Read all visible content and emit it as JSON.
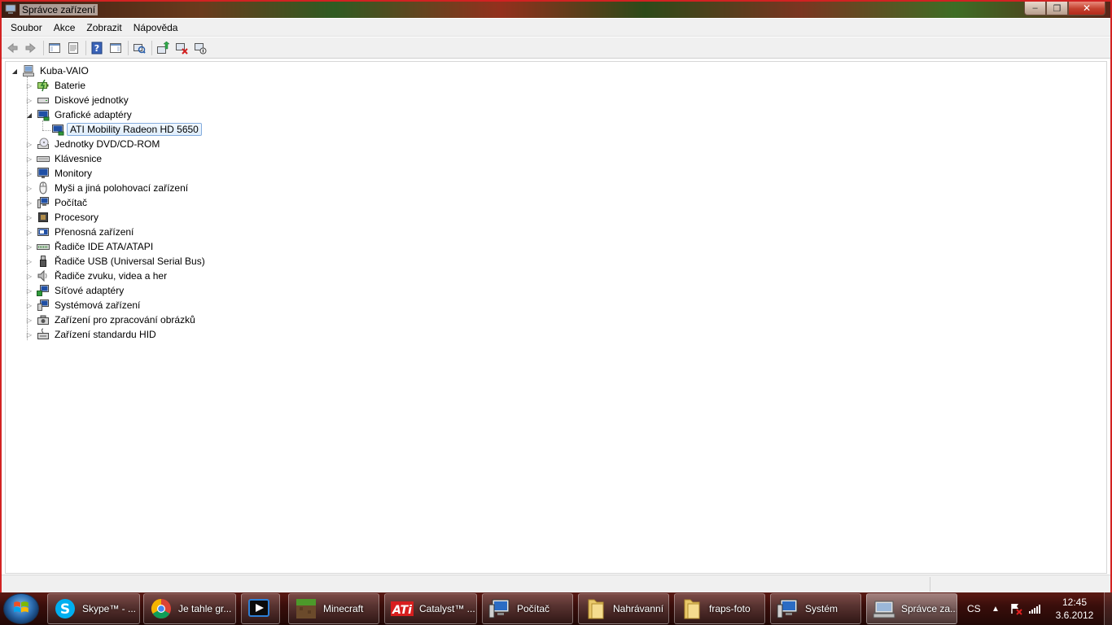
{
  "window": {
    "title": "Správce zařízení",
    "controls": {
      "minimize": "‒",
      "maximize": "❐",
      "close": "✕"
    }
  },
  "menu": [
    "Soubor",
    "Akce",
    "Zobrazit",
    "Nápověda"
  ],
  "toolbar": [
    "back-icon",
    "forward-icon",
    "console-tree-icon",
    "properties-icon",
    "help-icon",
    "action-pane-icon",
    "scan-hardware-icon",
    "update-driver-icon",
    "uninstall-icon",
    "disable-device-icon"
  ],
  "tree": {
    "root": "Kuba-VAIO",
    "items": [
      {
        "label": "Baterie",
        "icon": "battery-icon",
        "expanded": false
      },
      {
        "label": "Diskové jednotky",
        "icon": "disk-drive-icon",
        "expanded": false
      },
      {
        "label": "Grafické adaptéry",
        "icon": "display-adapter-icon",
        "expanded": true,
        "children": [
          {
            "label": "ATI Mobility Radeon HD 5650",
            "icon": "display-adapter-icon",
            "selected": true
          }
        ]
      },
      {
        "label": "Jednotky DVD/CD-ROM",
        "icon": "dvd-drive-icon",
        "expanded": false
      },
      {
        "label": "Klávesnice",
        "icon": "keyboard-icon",
        "expanded": false
      },
      {
        "label": "Monitory",
        "icon": "monitor-icon",
        "expanded": false
      },
      {
        "label": "Myši a jiná polohovací zařízení",
        "icon": "mouse-icon",
        "expanded": false
      },
      {
        "label": "Počítač",
        "icon": "computer-icon",
        "expanded": false
      },
      {
        "label": "Procesory",
        "icon": "processor-icon",
        "expanded": false
      },
      {
        "label": "Přenosná zařízení",
        "icon": "portable-device-icon",
        "expanded": false
      },
      {
        "label": "Řadiče IDE ATA/ATAPI",
        "icon": "ide-controller-icon",
        "expanded": false
      },
      {
        "label": "Řadiče USB (Universal Serial Bus)",
        "icon": "usb-icon",
        "expanded": false
      },
      {
        "label": "Řadiče zvuku, videa a her",
        "icon": "speaker-icon",
        "expanded": false
      },
      {
        "label": "Síťové adaptéry",
        "icon": "network-adapter-icon",
        "expanded": false
      },
      {
        "label": "Systémová zařízení",
        "icon": "system-device-icon",
        "expanded": false
      },
      {
        "label": "Zařízení pro zpracování obrázků",
        "icon": "camera-icon",
        "expanded": false
      },
      {
        "label": "Zařízení standardu HID",
        "icon": "hid-icon",
        "expanded": false
      }
    ]
  },
  "taskbar": {
    "items": [
      {
        "label": "Skype™ - ...",
        "icon": "skype-icon"
      },
      {
        "label": "Je tahle gr...",
        "icon": "chrome-icon"
      },
      {
        "label": "",
        "icon": "media-player-icon"
      },
      {
        "label": "Minecraft",
        "icon": "minecraft-icon"
      },
      {
        "label": "Catalyst™ ...",
        "icon": "ati-icon"
      },
      {
        "label": "Počítač",
        "icon": "computer-icon"
      },
      {
        "label": "Nahrávanní",
        "icon": "folder-icon"
      },
      {
        "label": "fraps-foto",
        "icon": "folder-icon"
      },
      {
        "label": "Systém",
        "icon": "computer-icon"
      },
      {
        "label": "Správce za...",
        "icon": "device-manager-icon",
        "active": true
      }
    ],
    "tray": {
      "language": "CS",
      "time": "12:45",
      "date": "3.6.2012"
    }
  }
}
